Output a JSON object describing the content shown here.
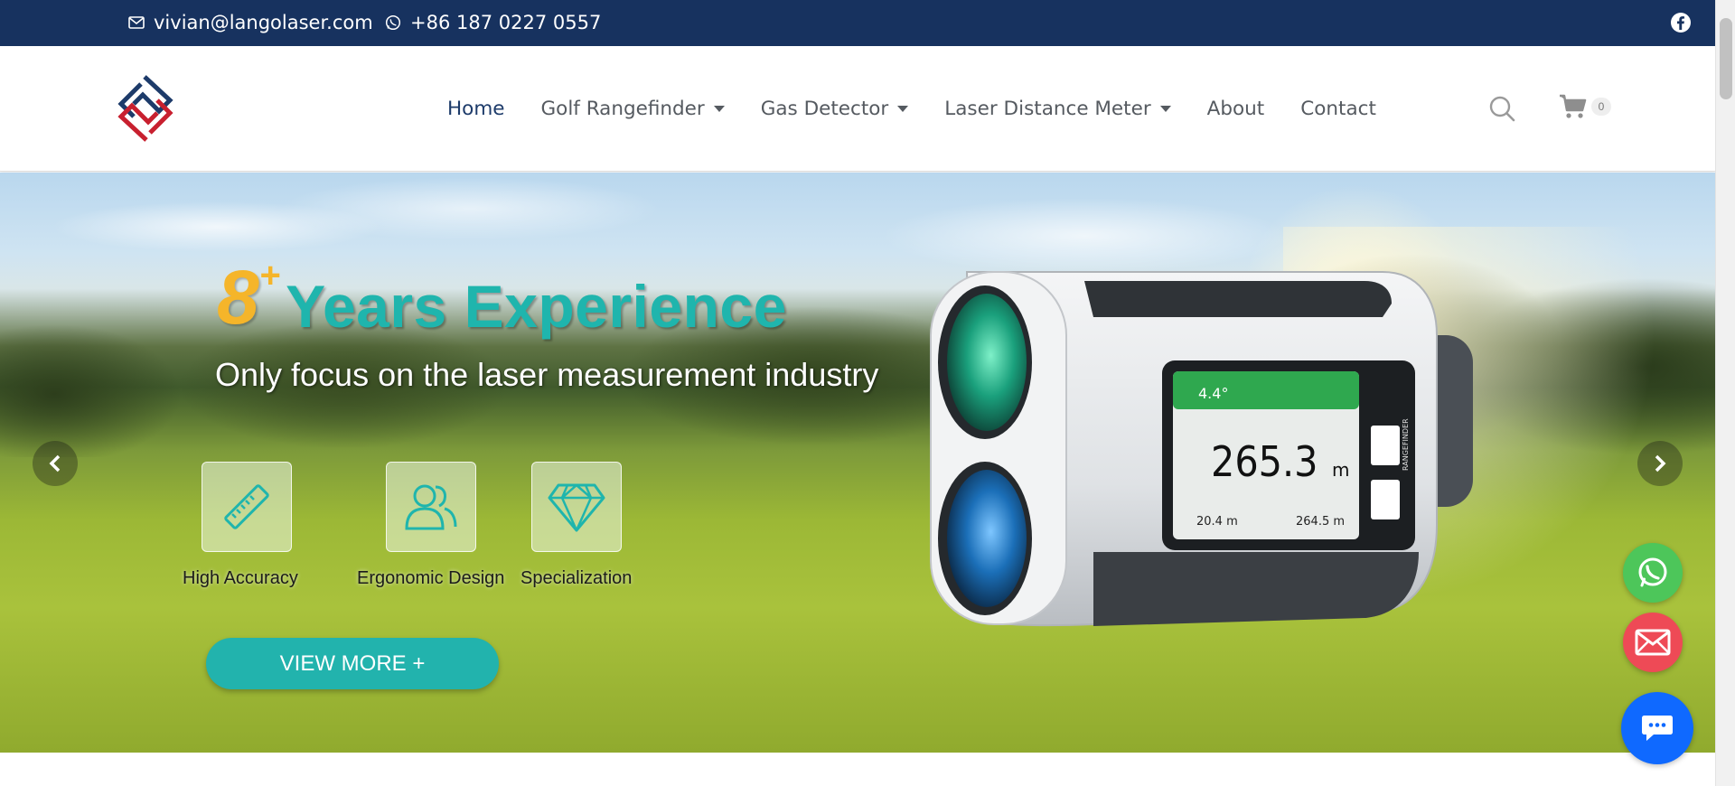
{
  "topbar": {
    "email": "vivian@langolaser.com",
    "phone": "+86 187 0227 0557"
  },
  "nav": {
    "items": [
      {
        "label": "Home",
        "active": true,
        "has_dropdown": false
      },
      {
        "label": "Golf Rangefinder",
        "active": false,
        "has_dropdown": true
      },
      {
        "label": "Gas Detector",
        "active": false,
        "has_dropdown": true
      },
      {
        "label": "Laser Distance Meter",
        "active": false,
        "has_dropdown": true
      },
      {
        "label": "About",
        "active": false,
        "has_dropdown": false
      },
      {
        "label": "Contact",
        "active": false,
        "has_dropdown": false
      }
    ],
    "cart_count": "0"
  },
  "hero": {
    "headline_number": "8",
    "headline_plus": "+",
    "headline_text": "Years Experience",
    "subline": "Only focus on the laser measurement industry",
    "features": [
      {
        "label": "High Accuracy",
        "icon": "ruler-icon"
      },
      {
        "label": "Ergonomic Design",
        "icon": "users-icon"
      },
      {
        "label": "Specialization",
        "icon": "diamond-icon"
      }
    ],
    "cta_label": "VIEW MORE +",
    "device_screen": {
      "angle": "4.4°",
      "distance_main": "265.3",
      "distance_unit": "m",
      "reading_left": "20.4 m",
      "reading_right": "264.5 m",
      "side_label": "RANGEFINDER"
    }
  },
  "colors": {
    "topbar_bg": "#17325f",
    "accent_teal": "#22b3ad",
    "headline_gold": "#f5b52a",
    "whatsapp_green": "#4dc65a",
    "mail_red": "#ee4a56",
    "chat_blue": "#0f69ff"
  }
}
